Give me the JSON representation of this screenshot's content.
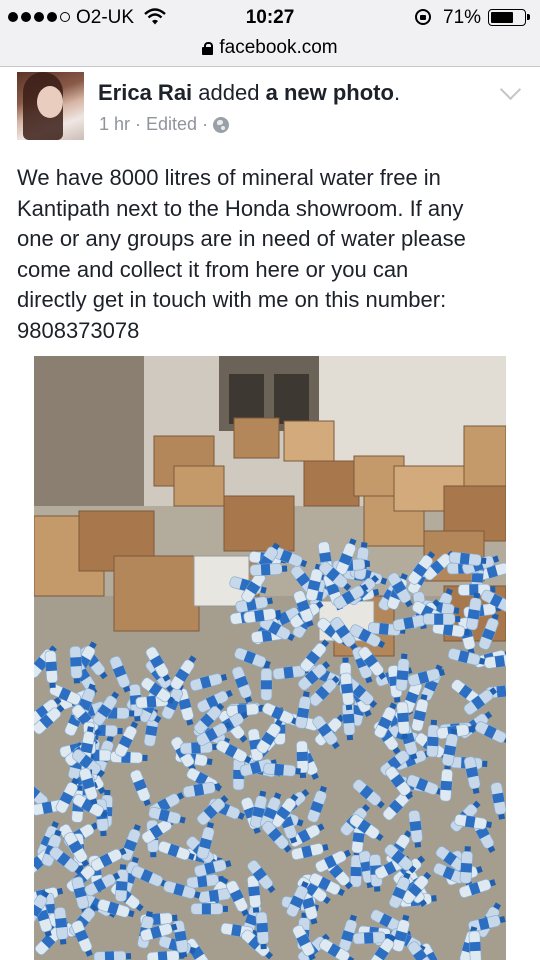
{
  "status_bar": {
    "carrier": "O2-UK",
    "time": "10:27",
    "battery_percent": "71%",
    "battery_level": 0.71,
    "signal_bars_filled": 4,
    "signal_bars_total": 5
  },
  "url_bar": {
    "url": "facebook.com"
  },
  "post": {
    "author": "Erica Rai",
    "action": "added",
    "object": "a new photo",
    "punct": ".",
    "time": "1 hr",
    "sep1": "·",
    "edited": "Edited",
    "sep2": "·",
    "text_lines": [
      "We have 8000 litres of mineral water free in",
      "Kantipath next to the Honda showroom. If any",
      "one or any groups are in need of water please",
      "come and collect it from here or you can",
      "directly get in touch with me on this number:",
      "9808373078"
    ],
    "privacy_icon": "globe-icon",
    "menu_icon": "chevron-down-icon",
    "photo_subject": "crates and bottles of mineral water"
  },
  "colors": {
    "text": "#1d2129",
    "meta": "#90949c",
    "bar": "#f1f1f3"
  }
}
